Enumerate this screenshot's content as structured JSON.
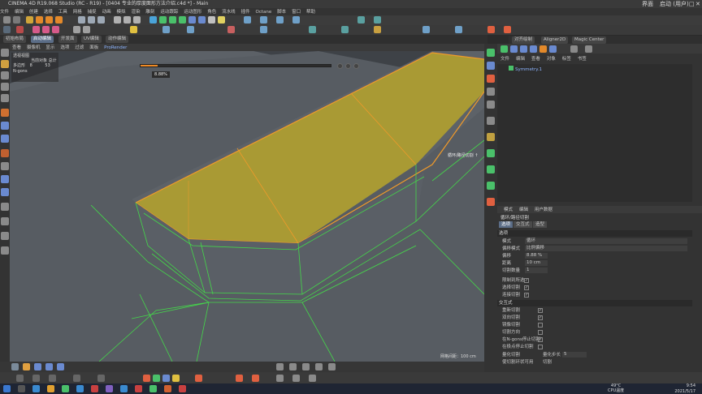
{
  "window": {
    "title": "CINEMA 4D R19.068 Studio (RC - R19) - [0404 专业的厚度面形方法介绍.c4d *] - Main",
    "right_labels": [
      "界面",
      "启动 (用户)"
    ]
  },
  "menubar": [
    "文件",
    "编辑",
    "创建",
    "选择",
    "工具",
    "网格",
    "捕捉",
    "动画",
    "模拟",
    "渲染",
    "雕刻",
    "运动跟踪",
    "运动图形",
    "角色",
    "流水线",
    "插件",
    "Octane",
    "脚本",
    "窗口",
    "帮助"
  ],
  "layout_tabs": [
    "初始布局",
    "启动编辑",
    "开发面",
    "UV编辑",
    "动作编辑"
  ],
  "active_layout_tab": "启动编辑",
  "viewport": {
    "menu": [
      "查看",
      "摄像机",
      "显示",
      "选项",
      "过滤",
      "面板",
      "ProRender"
    ],
    "view_name": "透视视图",
    "hud": {
      "header": "当前对象  总计",
      "rows": [
        {
          "label": "多边形",
          "current": "8",
          "total": "53"
        },
        {
          "label": "N-gons",
          "current": "",
          "total": ""
        }
      ]
    },
    "slider_value": "8.88%",
    "slider_fraction": 0.09,
    "tool_label": "循环/路径切割 ↑",
    "grid_spacing": "网格间距：100 cm"
  },
  "object_manager": {
    "menu": [
      "文件",
      "编辑",
      "查看",
      "对象",
      "标签",
      "书签"
    ],
    "objects": [
      "Symmetry.1"
    ],
    "top_right_tabs": [
      "对齐绘制",
      "Aligner2D",
      "Magic Center"
    ]
  },
  "attributes": {
    "menu": [
      "模式",
      "编辑",
      "用户数据"
    ],
    "title": "循环/路径切割",
    "tabs": [
      "选项",
      "交互式",
      "造型"
    ],
    "active_tab": "选项",
    "sections": {
      "options": "选项",
      "interactive": "交互式"
    },
    "rows": [
      {
        "label": "模式",
        "value": "循环"
      },
      {
        "label": "偏移模式",
        "value": "比例偏移"
      },
      {
        "label": "偏移",
        "value": "8.88 %"
      },
      {
        "label": "距离",
        "value": "10 cm"
      },
      {
        "label": "切割数量",
        "value": "1"
      }
    ],
    "checks": [
      {
        "label": "限制到所选",
        "checked": "✓"
      },
      {
        "label": "选择切割",
        "checked": "✓"
      },
      {
        "label": "连接切割",
        "checked": "✓"
      }
    ],
    "interactive_checks": [
      {
        "label": "重新切割",
        "checked": "✓"
      },
      {
        "label": "双向切割",
        "checked": "✓"
      },
      {
        "label": "镜像切割",
        "checked": ""
      },
      {
        "label": "切割方向",
        "checked": ""
      },
      {
        "label": "在N-gons停止切割",
        "checked": "✓"
      },
      {
        "label": "在极点停止切割",
        "checked": ""
      }
    ],
    "bottom": {
      "label1": "量化切割",
      "label2": "量化步长",
      "value2": "5",
      "label3": "使切割环状可用",
      "label4": "切割"
    }
  },
  "taskbar": {
    "weather": "49°C",
    "weather_sub": "CPU温度",
    "time": "9:54",
    "date": "2021/5/17"
  },
  "colors": {
    "accent": "#5b6d87",
    "selected_face": "#a99a34",
    "selected_edge": "#f09a2a",
    "wire": "#44d84a",
    "mesh": "#5a5f66"
  }
}
